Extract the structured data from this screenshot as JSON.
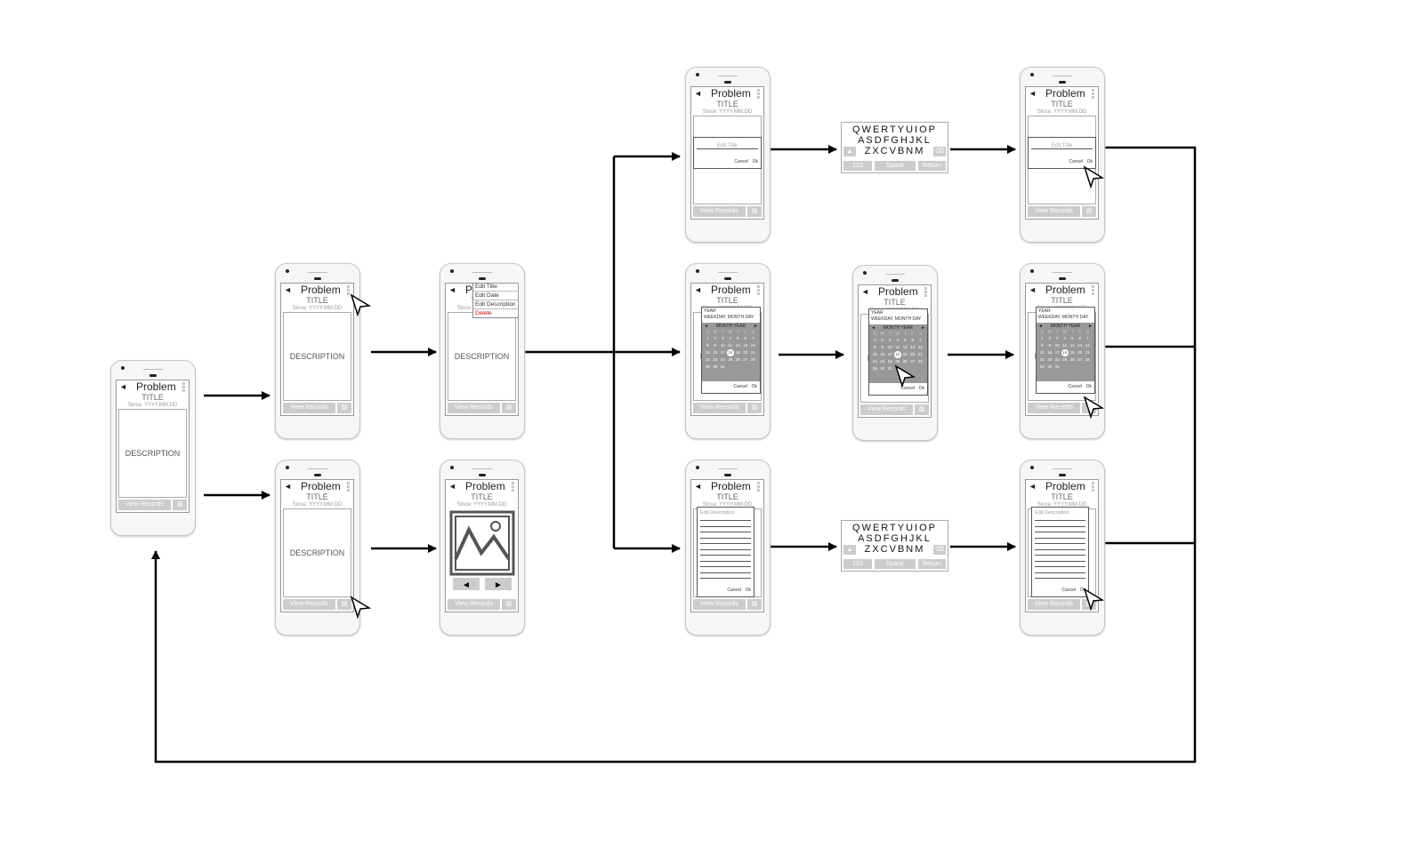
{
  "screen_text": {
    "back_icon": "◄",
    "header_title": "Problem",
    "title": "TITLE",
    "since": "Since: YYYY.MM.DD",
    "description": "DESCRIPTION",
    "view_records": "View Records",
    "add_record": "Add Record"
  },
  "menu": {
    "items": [
      "Edit Title",
      "Edit Date",
      "Edit Description"
    ],
    "delete": "Delete",
    "delete_color": "#cc0000"
  },
  "title_dialog": {
    "placeholder": "Edit Title",
    "cancel": "Cancel",
    "ok": "Ok"
  },
  "date_dialog": {
    "year": "YEAR",
    "weekday": "WEEKDAY, MONTH DAY",
    "month_year": "MONTH YEAR",
    "weekdays": [
      "S",
      "M",
      "T",
      "W",
      "T",
      "F",
      "S"
    ],
    "days": 31,
    "selected_day": 18,
    "cancel": "Cancel",
    "ok": "Ok"
  },
  "desc_dialog": {
    "placeholder": "Edit Description",
    "cancel": "Cancel",
    "ok": "Ok"
  },
  "keyboard": {
    "rows": [
      "QWERTYUIOP",
      "ASDFGHJKL",
      "ZXCVBNM"
    ],
    "num": "123",
    "space": "Space",
    "return": "Return",
    "shift_icon": "▲",
    "backspace_icon": "⌫"
  },
  "phones": [
    {
      "id": "home",
      "variant": "description",
      "cursor": false
    },
    {
      "id": "menu-tap",
      "variant": "description",
      "cursor": true
    },
    {
      "id": "menu-open",
      "variant": "menu",
      "cursor": false
    },
    {
      "id": "image-tap",
      "variant": "description",
      "cursor": true
    },
    {
      "id": "image-view",
      "variant": "image",
      "cursor": false
    },
    {
      "id": "edit-title",
      "variant": "title",
      "cursor": false
    },
    {
      "id": "edit-title-ok",
      "variant": "title",
      "cursor": true
    },
    {
      "id": "edit-date",
      "variant": "date",
      "cursor": false
    },
    {
      "id": "edit-date-pick",
      "variant": "date",
      "cursor": true
    },
    {
      "id": "edit-date-ok",
      "variant": "date",
      "cursor": true
    },
    {
      "id": "edit-desc",
      "variant": "desc",
      "cursor": false
    },
    {
      "id": "edit-desc-ok",
      "variant": "desc",
      "cursor": true
    }
  ],
  "keyboards": [
    "keyboard-title",
    "keyboard-description"
  ]
}
